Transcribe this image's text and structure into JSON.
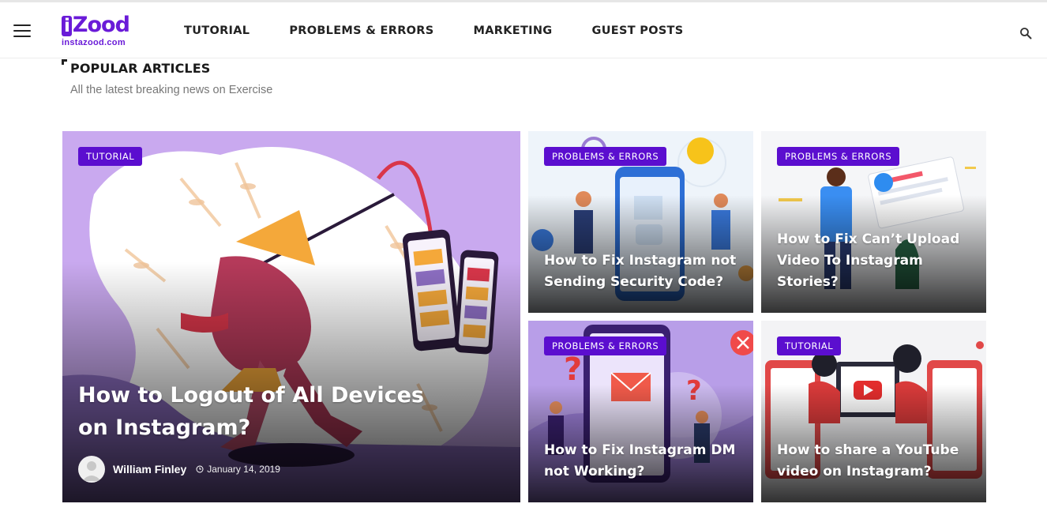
{
  "header": {
    "logo_text": "Zood",
    "logo_letter": "i",
    "logo_sub": "instazood.com",
    "nav": [
      "TUTORIAL",
      "PROBLEMS & ERRORS",
      "MARKETING",
      "GUEST POSTS"
    ]
  },
  "section": {
    "title": "POPULAR ARTICLES",
    "subtitle": "All the latest breaking news on Exercise"
  },
  "articles": [
    {
      "category": "TUTORIAL",
      "title": "How to Logout of All Devices on Instagram?",
      "author": "William Finley",
      "date": "January 14, 2019"
    },
    {
      "category": "PROBLEMS & ERRORS",
      "title": "How to Fix Instagram not Sending Security Code?"
    },
    {
      "category": "PROBLEMS & ERRORS",
      "title": "How to Fix Can’t Upload Video To Instagram Stories?"
    },
    {
      "category": "PROBLEMS & ERRORS",
      "title": "How to Fix Instagram DM not Working?"
    },
    {
      "category": "TUTORIAL",
      "title": "How to share a YouTube video on Instagram?"
    }
  ],
  "colors": {
    "accent": "#5b0ecf",
    "brand": "#6a1bd8"
  },
  "icons": [
    "menu-icon",
    "search-icon",
    "clock-icon",
    "avatar-icon"
  ]
}
